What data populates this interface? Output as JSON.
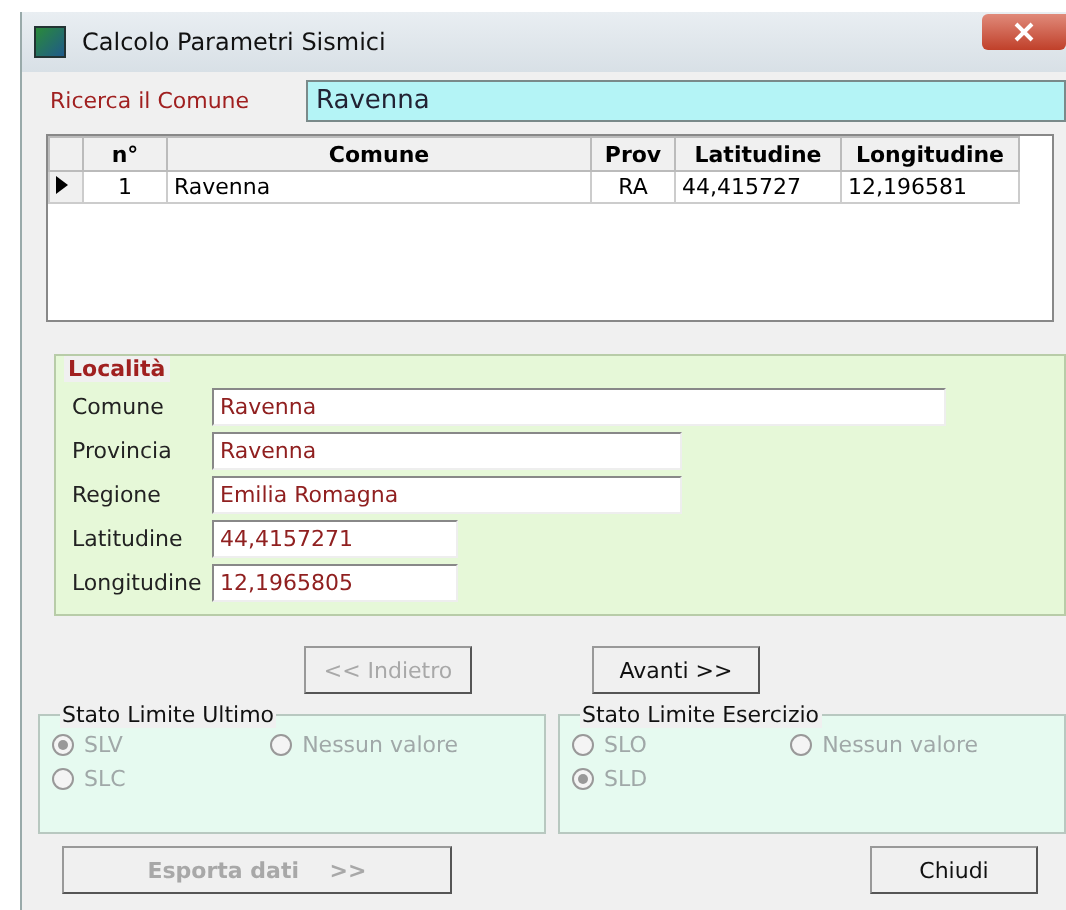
{
  "window": {
    "title": "Calcolo Parametri Sismici"
  },
  "search": {
    "label": "Ricerca il Comune",
    "value": "Ravenna"
  },
  "table": {
    "columns": [
      "n°",
      "Comune",
      "Prov",
      "Latitudine",
      "Longitudine"
    ],
    "rows": [
      {
        "selected": true,
        "cells": [
          "1",
          "Ravenna",
          "RA",
          "44,415727",
          "12,196581"
        ]
      }
    ]
  },
  "locality": {
    "title": "Località",
    "fields": [
      {
        "label": "Comune",
        "value": "Ravenna"
      },
      {
        "label": "Provincia",
        "value": "Ravenna"
      },
      {
        "label": "Regione",
        "value": "Emilia Romagna"
      },
      {
        "label": "Latitudine",
        "value": "44,4157271"
      },
      {
        "label": "Longitudine",
        "value": "12,1965805"
      }
    ]
  },
  "nav_buttons": [
    {
      "label": "<< Indietro",
      "disabled": true
    },
    {
      "label": "Avanti >>",
      "disabled": false
    }
  ],
  "groups": [
    {
      "title": "Stato Limite Ultimo",
      "options": [
        {
          "label": "SLV",
          "selected": true,
          "disabled": true
        },
        {
          "label": "Nessun valore",
          "selected": false,
          "disabled": true
        },
        {
          "label": "SLC",
          "selected": false,
          "disabled": true
        }
      ]
    },
    {
      "title": "Stato Limite Esercizio",
      "options": [
        {
          "label": "SLO",
          "selected": false,
          "disabled": true
        },
        {
          "label": "Nessun valore",
          "selected": false,
          "disabled": true
        },
        {
          "label": "SLD",
          "selected": true,
          "disabled": true
        }
      ]
    }
  ],
  "bottom_buttons": [
    {
      "label": "Esporta dati    >>",
      "disabled": true
    },
    {
      "label": "Chiudi",
      "disabled": false
    }
  ]
}
